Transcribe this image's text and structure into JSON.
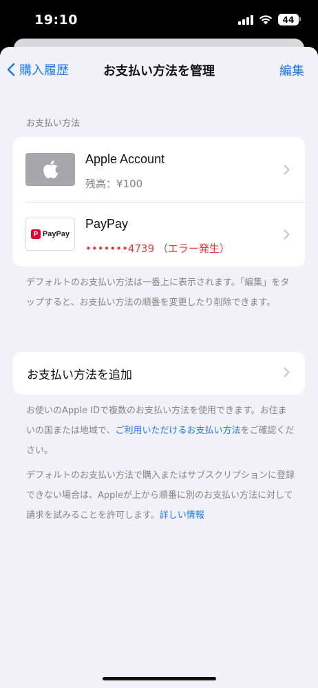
{
  "status_bar": {
    "time": "19:10",
    "battery": "44"
  },
  "nav": {
    "back_label": "購入履歴",
    "title": "お支払い方法を管理",
    "edit_label": "編集"
  },
  "methods_section": {
    "header": "お支払い方法",
    "items": [
      {
        "name": "Apple Account",
        "detail": "残高：¥100",
        "icon": "apple-logo-icon"
      },
      {
        "name": "PayPay",
        "detail": "•••••••4739 （エラー発生）",
        "icon": "paypay-logo-icon",
        "logo_text": "PayPay",
        "status_color": "#e5393a"
      }
    ],
    "footnote": "デフォルトのお支払い方法は一番上に表示されます。「編集」をタップすると、お支払い方法の順番を変更したり削除できます。"
  },
  "add_method": {
    "label": "お支払い方法を追加"
  },
  "info": {
    "p1_before": "お使いのApple IDで複数のお支払い方法を使用できます。お住まいの国または地域で、",
    "p1_link": "ご利用いただけるお支払い方法",
    "p1_after": "をご確認ください。",
    "p2_before": "デフォルトのお支払い方法で購入またはサブスクリプションに登録できない場合は、Appleが上から順番に別のお支払い方法に対して請求を試みることを許可します。",
    "p2_link": "詳しい情報"
  },
  "colors": {
    "accent": "#1a7cf2",
    "background": "#f2f1f7",
    "error": "#e5393a"
  }
}
